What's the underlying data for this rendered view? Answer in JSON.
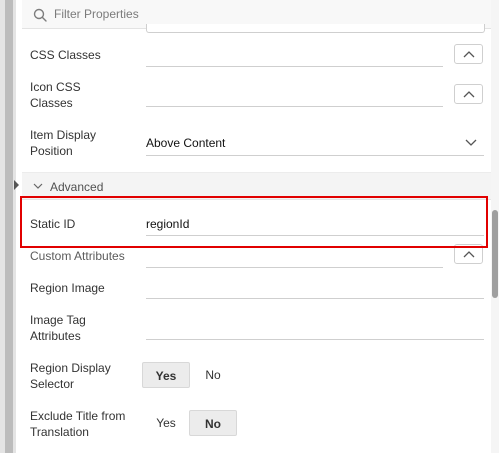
{
  "filter": {
    "placeholder": "Filter Properties"
  },
  "properties": {
    "css_classes": {
      "label": "CSS Classes",
      "value": ""
    },
    "icon_css_classes": {
      "label_line1": "Icon CSS",
      "label_line2": "Classes",
      "value": ""
    },
    "item_display_position": {
      "label_line1": "Item Display",
      "label_line2": "Position",
      "value": "Above Content"
    }
  },
  "advanced": {
    "group_title": "Advanced",
    "static_id": {
      "label": "Static ID",
      "value": "regionId"
    },
    "custom_attributes": {
      "label": "Custom Attributes",
      "value": ""
    },
    "region_image": {
      "label": "Region Image",
      "value": ""
    },
    "image_tag_attributes": {
      "label_line1": "Image Tag",
      "label_line2": "Attributes",
      "value": ""
    },
    "region_display_selector": {
      "label_line1": "Region Display",
      "label_line2": "Selector",
      "yes": "Yes",
      "no": "No",
      "selected": "Yes"
    },
    "exclude_title_from_translation": {
      "label_line1": "Exclude Title from",
      "label_line2": "Translation",
      "yes": "Yes",
      "no": "No",
      "selected": "No"
    }
  },
  "colors": {
    "highlight": "#e10000"
  },
  "icons": {
    "filter": "search-icon",
    "expand": "chevron-up-icon",
    "dropdown": "chevron-down-icon",
    "group": "chevron-down-icon",
    "panel_handle": "caret-right-icon"
  }
}
